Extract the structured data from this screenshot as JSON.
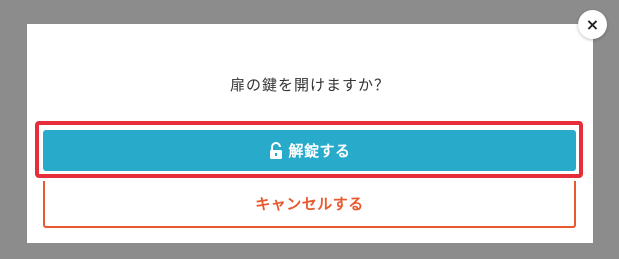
{
  "dialog": {
    "message": "扉の鍵を開けますか？",
    "close_icon": "×",
    "unlock_label": "解錠する",
    "cancel_label": "キャンセルする"
  },
  "icons": {
    "close": "close-icon",
    "unlock": "unlock-icon"
  },
  "colors": {
    "backdrop": "#8c8c8c",
    "primary": "#28aacb",
    "highlight": "#e52e3a",
    "cancel": "#e8592e"
  }
}
